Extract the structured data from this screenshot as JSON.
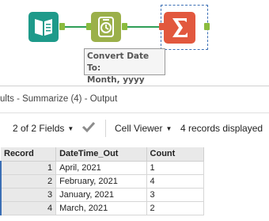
{
  "workflow": {
    "annotation": {
      "line1": "Convert Date To:",
      "line2": "Month, yyyy"
    },
    "tools": {
      "input": "input-book-icon",
      "formula": "datetime-clock-icon",
      "summarize": "summarize-sigma-icon"
    }
  },
  "results": {
    "title": "ults - Summarize (4) - Output"
  },
  "toolbar": {
    "fields_label": "2 of 2 Fields",
    "viewer_label": "Cell Viewer",
    "records_label": "4 records displayed"
  },
  "table": {
    "columns": [
      "Record",
      "DateTime_Out",
      "Count"
    ],
    "rows": [
      {
        "record": "1",
        "datetime_out": "April, 2021",
        "count": "1"
      },
      {
        "record": "2",
        "datetime_out": "February, 2021",
        "count": "4"
      },
      {
        "record": "3",
        "datetime_out": "January, 2021",
        "count": "3"
      },
      {
        "record": "4",
        "datetime_out": "March, 2021",
        "count": "2"
      }
    ]
  },
  "colors": {
    "input_tool": "#1e9a8a",
    "formula_tool": "#9bb04a",
    "summarize_tool": "#e2583e",
    "connection": "#2f9e57",
    "selection": "#3b6fb5"
  }
}
